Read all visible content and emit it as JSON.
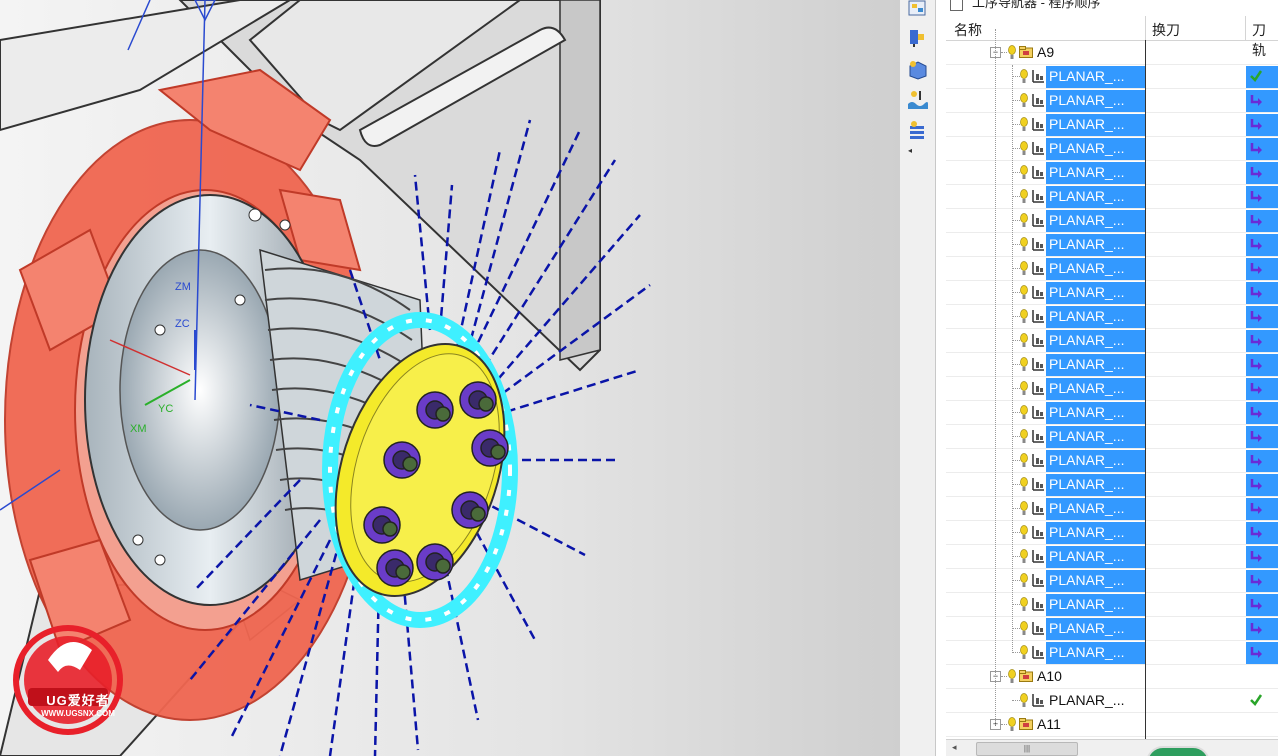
{
  "navigator": {
    "title": "工序导航器 - 程序顺序",
    "columns": {
      "name": "名称",
      "tool_change": "换刀",
      "tool_path": "刀轨"
    },
    "rows": [
      {
        "type": "group",
        "label": "A9",
        "expander": "−",
        "status": ""
      },
      {
        "type": "op",
        "label": "PLANAR_...",
        "selected": true,
        "status": "check"
      },
      {
        "type": "op",
        "label": "PLANAR_...",
        "selected": true,
        "status": "regen"
      },
      {
        "type": "op",
        "label": "PLANAR_...",
        "selected": true,
        "status": "regen"
      },
      {
        "type": "op",
        "label": "PLANAR_...",
        "selected": true,
        "status": "regen"
      },
      {
        "type": "op",
        "label": "PLANAR_...",
        "selected": true,
        "status": "regen"
      },
      {
        "type": "op",
        "label": "PLANAR_...",
        "selected": true,
        "status": "regen"
      },
      {
        "type": "op",
        "label": "PLANAR_...",
        "selected": true,
        "status": "regen"
      },
      {
        "type": "op",
        "label": "PLANAR_...",
        "selected": true,
        "status": "regen"
      },
      {
        "type": "op",
        "label": "PLANAR_...",
        "selected": true,
        "status": "regen"
      },
      {
        "type": "op",
        "label": "PLANAR_...",
        "selected": true,
        "status": "regen"
      },
      {
        "type": "op",
        "label": "PLANAR_...",
        "selected": true,
        "status": "regen"
      },
      {
        "type": "op",
        "label": "PLANAR_...",
        "selected": true,
        "status": "regen"
      },
      {
        "type": "op",
        "label": "PLANAR_...",
        "selected": true,
        "status": "regen"
      },
      {
        "type": "op",
        "label": "PLANAR_...",
        "selected": true,
        "status": "regen"
      },
      {
        "type": "op",
        "label": "PLANAR_...",
        "selected": true,
        "status": "regen"
      },
      {
        "type": "op",
        "label": "PLANAR_...",
        "selected": true,
        "status": "regen"
      },
      {
        "type": "op",
        "label": "PLANAR_...",
        "selected": true,
        "status": "regen"
      },
      {
        "type": "op",
        "label": "PLANAR_...",
        "selected": true,
        "status": "regen"
      },
      {
        "type": "op",
        "label": "PLANAR_...",
        "selected": true,
        "status": "regen"
      },
      {
        "type": "op",
        "label": "PLANAR_...",
        "selected": true,
        "status": "regen"
      },
      {
        "type": "op",
        "label": "PLANAR_...",
        "selected": true,
        "status": "regen"
      },
      {
        "type": "op",
        "label": "PLANAR_...",
        "selected": true,
        "status": "regen"
      },
      {
        "type": "op",
        "label": "PLANAR_...",
        "selected": true,
        "status": "regen"
      },
      {
        "type": "op",
        "label": "PLANAR_...",
        "selected": true,
        "status": "regen"
      },
      {
        "type": "op",
        "label": "PLANAR_...",
        "selected": true,
        "status": "regen"
      },
      {
        "type": "group",
        "label": "A10",
        "expander": "−",
        "status": ""
      },
      {
        "type": "op",
        "label": "PLANAR_...",
        "selected": false,
        "status": "check"
      },
      {
        "type": "group",
        "label": "A11",
        "expander": "+",
        "status": ""
      }
    ],
    "scrollbar_grip": "|||"
  },
  "viewport": {
    "axis_labels": {
      "zm": "ZM",
      "zc": "ZC",
      "yc": "YC",
      "xm": "XM"
    },
    "watermark": {
      "brand": "UG爱好者",
      "url": "WWW.UGSNX.COM"
    }
  },
  "toolbar_strip": {
    "icons": [
      "program-order-view-icon",
      "machine-tool-view-icon",
      "geometry-view-icon",
      "method-view-icon",
      "operation-list-icon"
    ],
    "collapse_arrow": "◂"
  },
  "colors": {
    "selection": "#3399ff",
    "check": "#2aa52a",
    "regen": "#6a2bd6",
    "fixture_red": "#f06650",
    "tool_path_blue": "#0a14a8",
    "part_yellow": "#f4ea2a",
    "part_cyan": "#3ff0ff",
    "nut_purple": "#6a3cc8"
  }
}
